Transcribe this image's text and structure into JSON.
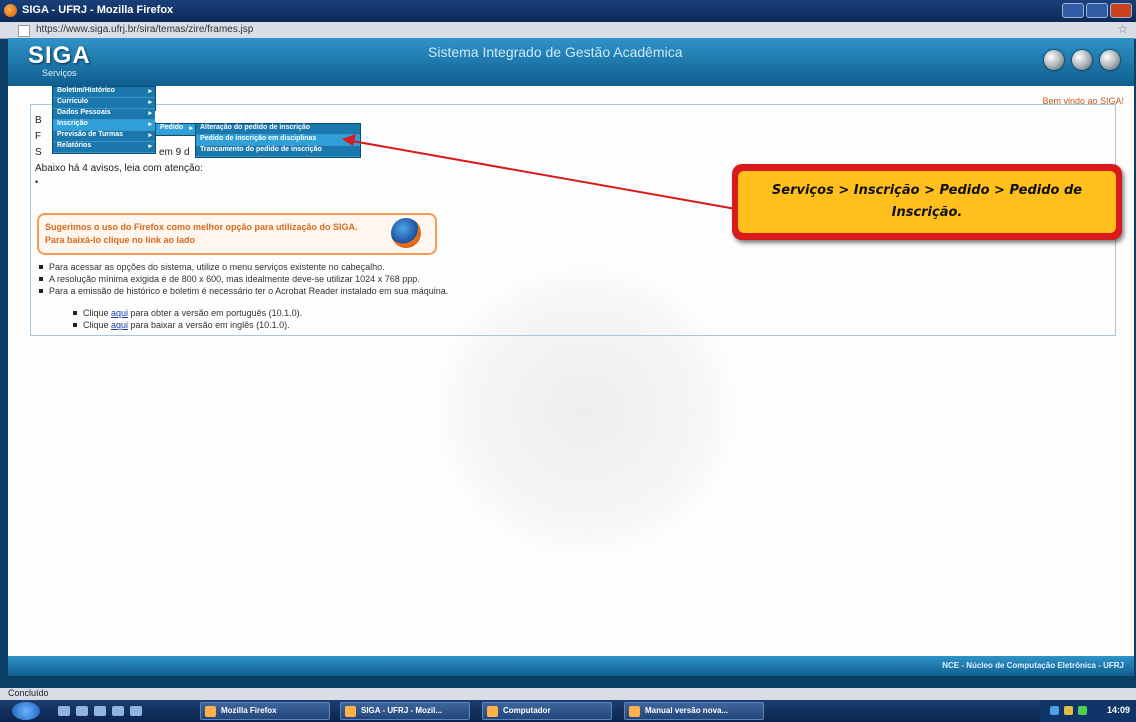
{
  "window": {
    "title": "SIGA - UFRJ - Mozilla Firefox"
  },
  "browser": {
    "url": "https://www.siga.ufrj.br/sira/temas/zire/frames.jsp",
    "status": "Concluído"
  },
  "header": {
    "logo": "SIGA",
    "slogan": "Sistema Integrado de Gestão Acadêmica",
    "services_label": "Serviços"
  },
  "content": {
    "welcome": "Bem vindo ao SIGA!",
    "line1_prefix": "B",
    "line2_prefix": "F",
    "line3_prefix": "S",
    "line3_suffix": "em 9 d",
    "avisos": "Abaixo há 4 avisos, leia com atenção:",
    "firefox_tip": "Sugerimos o uso do Firefox como melhor opção para utilização do SIGA. Para baixá-lo clique no link ao lado",
    "bullets": [
      "Para acessar as opções do sistema, utilize o menu serviços existente no cabeçalho.",
      "A resolução mínima exigida é de 800 x 600, mas idealmente deve-se utilizar 1024 x 768 ppp.",
      "Para a emissão de histórico e boletim é necessário ter o Acrobat Reader instalado em sua máquina."
    ],
    "sub_bullets": [
      {
        "pre": "Clique ",
        "link": "aqui",
        "post": " para obter a versão em português (10.1.0)."
      },
      {
        "pre": "Clique ",
        "link": "aqui",
        "post": " para baixar a versão em inglês (10.1.0)."
      }
    ]
  },
  "menu": {
    "level1": [
      "Boletim/Histórico",
      "Currículo",
      "Dados Pessoais",
      "Inscrição",
      "Previsão de Turmas",
      "Relatórios"
    ],
    "level2": [
      "Pedido"
    ],
    "level3": [
      "Alteração do pedido de inscrição",
      "Pedido de inscrição em disciplinas",
      "Trancamento do pedido de inscrição"
    ]
  },
  "callout": {
    "text": "Serviços > Inscrição > Pedido > Pedido de Inscrição."
  },
  "footer": {
    "text": "NCE - Núcleo de Computação Eletrônica - UFRJ"
  },
  "taskbar": {
    "items": [
      "Mozilla Firefox",
      "SIGA - UFRJ - Mozil...",
      "Computador",
      "Manual versão nova..."
    ],
    "clock": "14:09"
  },
  "colors": {
    "header_blue": "#1a78ad",
    "callout_red": "#d81a1a",
    "callout_yellow": "#ffbf1c",
    "firefox_orange": "#f29b52"
  }
}
